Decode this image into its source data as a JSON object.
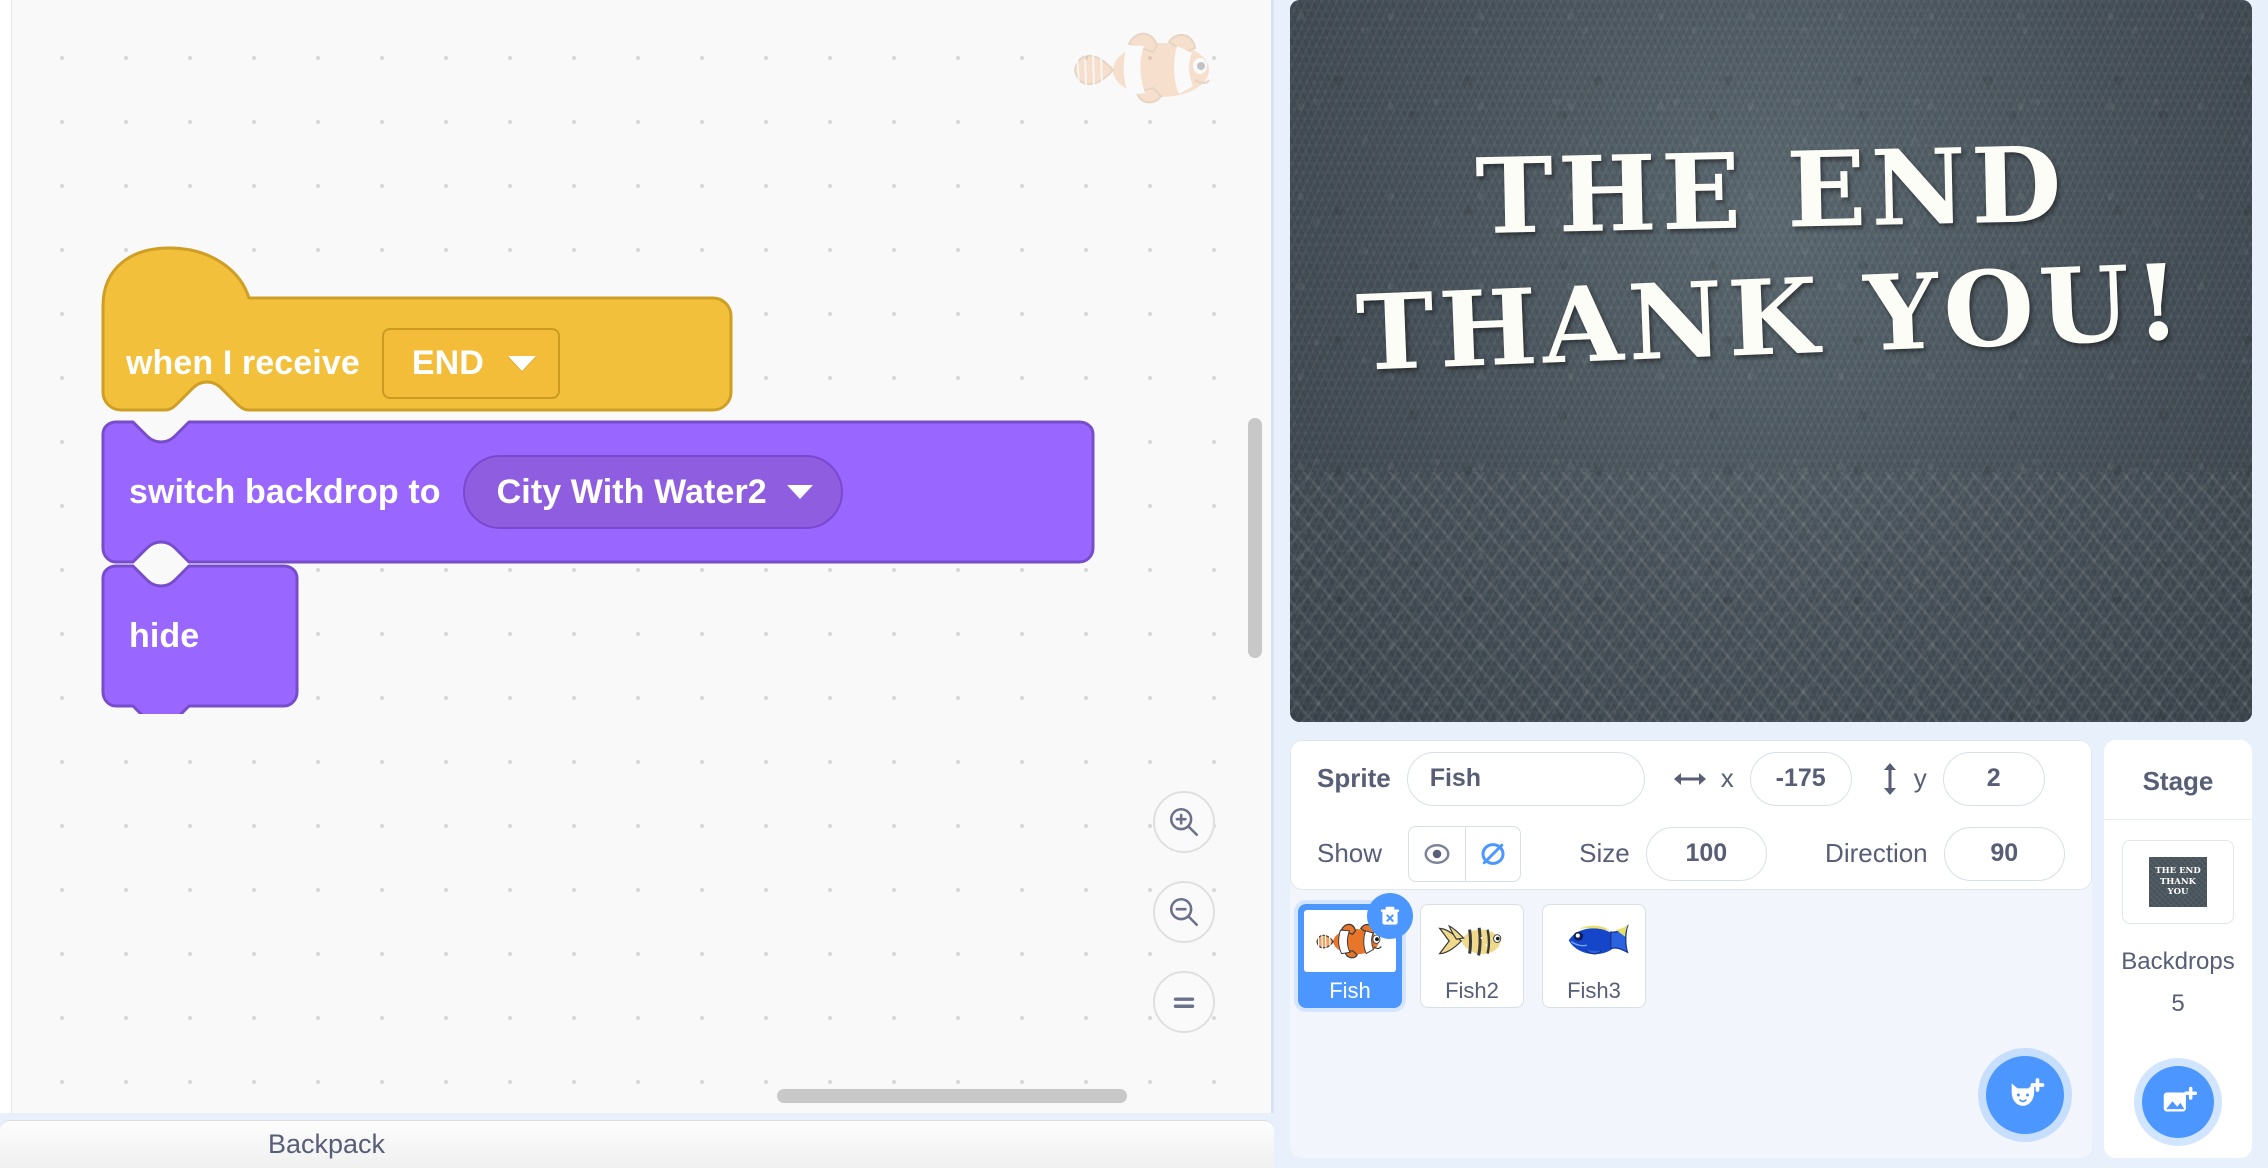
{
  "code_area": {
    "watermark_icon": "clownfish-sprite-watermark",
    "script": {
      "hat_block": {
        "label": "when I receive",
        "dropdown_value": "END",
        "dropdown_icon": "chevron-down-icon",
        "color": "#f2c03a"
      },
      "blocks": [
        {
          "label": "switch backdrop to",
          "dropdown_value": "City With Water2",
          "dropdown_icon": "chevron-down-icon",
          "color": "#9966ff"
        },
        {
          "label": "hide",
          "color": "#9966ff"
        }
      ]
    },
    "zoom_controls": {
      "zoom_in": "zoom-in-icon",
      "zoom_out": "zoom-out-icon",
      "zoom_reset": "zoom-reset-icon"
    }
  },
  "backpack": {
    "label": "Backpack"
  },
  "stage": {
    "text_line1": "THE END",
    "text_line2": "THANK YOU!"
  },
  "sprite_info": {
    "sprite_label": "Sprite",
    "sprite_name": "Fish",
    "x_label": "x",
    "x_value": "-175",
    "y_label": "y",
    "y_value": "2",
    "show_label": "Show",
    "show_icon": "eye-icon",
    "hide_icon": "eye-slash-icon",
    "size_label": "Size",
    "size_value": "100",
    "direction_label": "Direction",
    "direction_value": "90",
    "accent_color": "#4c97ff"
  },
  "sprite_list": {
    "sprites": [
      {
        "name": "Fish",
        "selected": true,
        "icon": "clownfish-icon"
      },
      {
        "name": "Fish2",
        "selected": false,
        "icon": "yellow-fish-icon"
      },
      {
        "name": "Fish3",
        "selected": false,
        "icon": "blue-tang-fish-icon"
      }
    ],
    "delete_icon": "trash-delete-icon",
    "add_sprite_icon": "add-sprite-cat-icon"
  },
  "stage_selector": {
    "title": "Stage",
    "thumb_line1": "THE END",
    "thumb_line2": "THANK YOU",
    "backdrops_label": "Backdrops",
    "backdrops_count": "5",
    "add_backdrop_icon": "add-backdrop-image-icon"
  }
}
